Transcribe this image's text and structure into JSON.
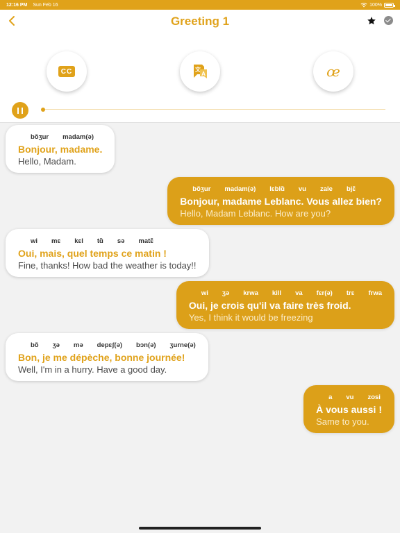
{
  "status_bar": {
    "time": "12:16 PM",
    "date": "Sun Feb 16",
    "battery": "100%"
  },
  "header": {
    "title": "Greeting 1"
  },
  "toolbar": {
    "cc_label": "CC",
    "phonetic_label": "œ"
  },
  "player": {
    "progress": 0.0
  },
  "colors": {
    "accent": "#e0a21a",
    "left_bubble": "#ffffff",
    "right_bubble": "#dca019",
    "background": "#f2f2f2"
  },
  "messages": [
    {
      "side": "left",
      "phonetics": [
        "bõʒur",
        "madam(ə)"
      ],
      "french": "Bonjour, madame.",
      "english": "Hello, Madam."
    },
    {
      "side": "right",
      "phonetics": [
        "bõʒur",
        "madam(ə)",
        "lɛblɑ̃",
        "vu",
        "zale",
        "bjɛ̃"
      ],
      "french": "Bonjour, madame Leblanc. Vous allez bien?",
      "english": "Hello, Madam Leblanc. How are you?"
    },
    {
      "side": "left",
      "phonetics": [
        "wi",
        "mɛ",
        "kɛl",
        "tɑ̃",
        "sə",
        "matɛ̃"
      ],
      "french": "Oui, mais, quel temps ce matin !",
      "english": "Fine, thanks! How bad the weather is today!!"
    },
    {
      "side": "right",
      "phonetics": [
        "wi",
        "ʒə",
        "krwa",
        "kill",
        "va",
        "fɛr(ə)",
        "trɛ",
        "frwa"
      ],
      "french": "Oui, je crois qu'il va faire très froid.",
      "english": "Yes, I think it would be freezing"
    },
    {
      "side": "left",
      "phonetics": [
        "bõ",
        "ʒə",
        "mə",
        "depɛʃ(ə)",
        "bɔn(ə)",
        "ʒurne(ə)"
      ],
      "french": "Bon, je me dépèche, bonne journée!",
      "english": "Well, I'm in a hurry. Have a good day."
    },
    {
      "side": "right",
      "phonetics": [
        "a",
        "vu",
        "zosi"
      ],
      "french": "À vous aussi !",
      "english": "Same to you."
    }
  ]
}
